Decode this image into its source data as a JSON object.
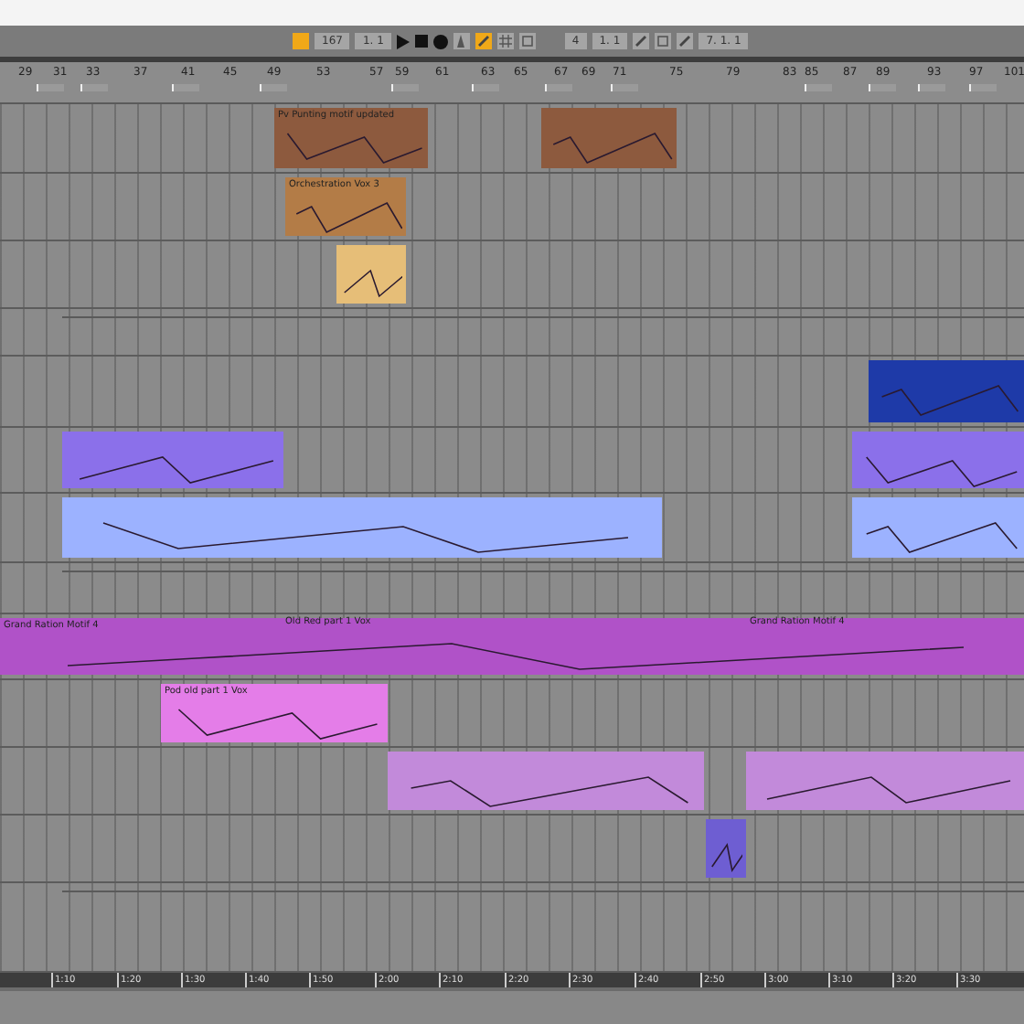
{
  "toolbar": {
    "follow_on": true,
    "left_fields": [
      "167",
      "1. 1"
    ],
    "mode_buttons": [
      {
        "kind": "metronome",
        "selected": false
      },
      {
        "kind": "pencil",
        "selected": true
      },
      {
        "kind": "grid",
        "selected": false
      },
      {
        "kind": "loop",
        "selected": false
      }
    ],
    "right_fields": [
      "4",
      "1. 1"
    ],
    "edit_buttons": [
      {
        "kind": "pencil",
        "selected": false
      },
      {
        "kind": "loop",
        "selected": false
      },
      {
        "kind": "pencil",
        "selected": false
      }
    ],
    "end_field": "7. 1. 1"
  },
  "bars": [
    "29",
    "31",
    "33",
    "37",
    "41",
    "45",
    "49",
    "53",
    "57",
    "59",
    "61",
    "63",
    "65",
    "67",
    "69",
    "71",
    "75",
    "79",
    "83",
    "85",
    "87",
    "89",
    "93",
    "97",
    "101"
  ],
  "tracks": [
    {
      "clips": [
        {
          "name": "Pv Punting motif updated",
          "color": "#8d5a3e"
        },
        {
          "color": "#8d5a3e"
        }
      ]
    },
    {
      "clips": [
        {
          "name": "Orchestration Vox 3",
          "color": "#b37c47"
        }
      ]
    },
    {
      "clips": [
        {
          "color": "#e6be78"
        }
      ]
    },
    {
      "kind": "empty"
    },
    {
      "clips": [
        {
          "color": "#1e3aa8"
        }
      ]
    },
    {
      "clips": [
        {
          "color": "#8b70ea"
        },
        {
          "color": "#8b70ea"
        }
      ]
    },
    {
      "clips": [
        {
          "color": "#9cb2ff"
        },
        {
          "color": "#9cb2ff"
        }
      ]
    },
    {
      "kind": "empty"
    },
    {
      "clips": [
        {
          "name": "Grand Ration Motif 4",
          "color": "#b052c8"
        }
      ]
    },
    {
      "clips": [
        {
          "name": "Pod old part 1 Vox",
          "color": "#e47de8"
        }
      ]
    },
    {
      "clips": [
        {
          "color": "#c28ada"
        },
        {
          "color": "#c28ada"
        }
      ]
    },
    {
      "clips": [
        {
          "color": "#6e5ed2"
        }
      ]
    },
    {
      "kind": "empty"
    }
  ],
  "overlay_labels": [
    "Old Red part 1 Vox",
    "Grand Ration Motif 4"
  ],
  "times": [
    "1:10",
    "1:20",
    "1:30",
    "1:40",
    "1:50",
    "2:00",
    "2:10",
    "2:20",
    "2:30",
    "2:40",
    "2:50",
    "3:00",
    "3:10",
    "3:20",
    "3:30"
  ]
}
